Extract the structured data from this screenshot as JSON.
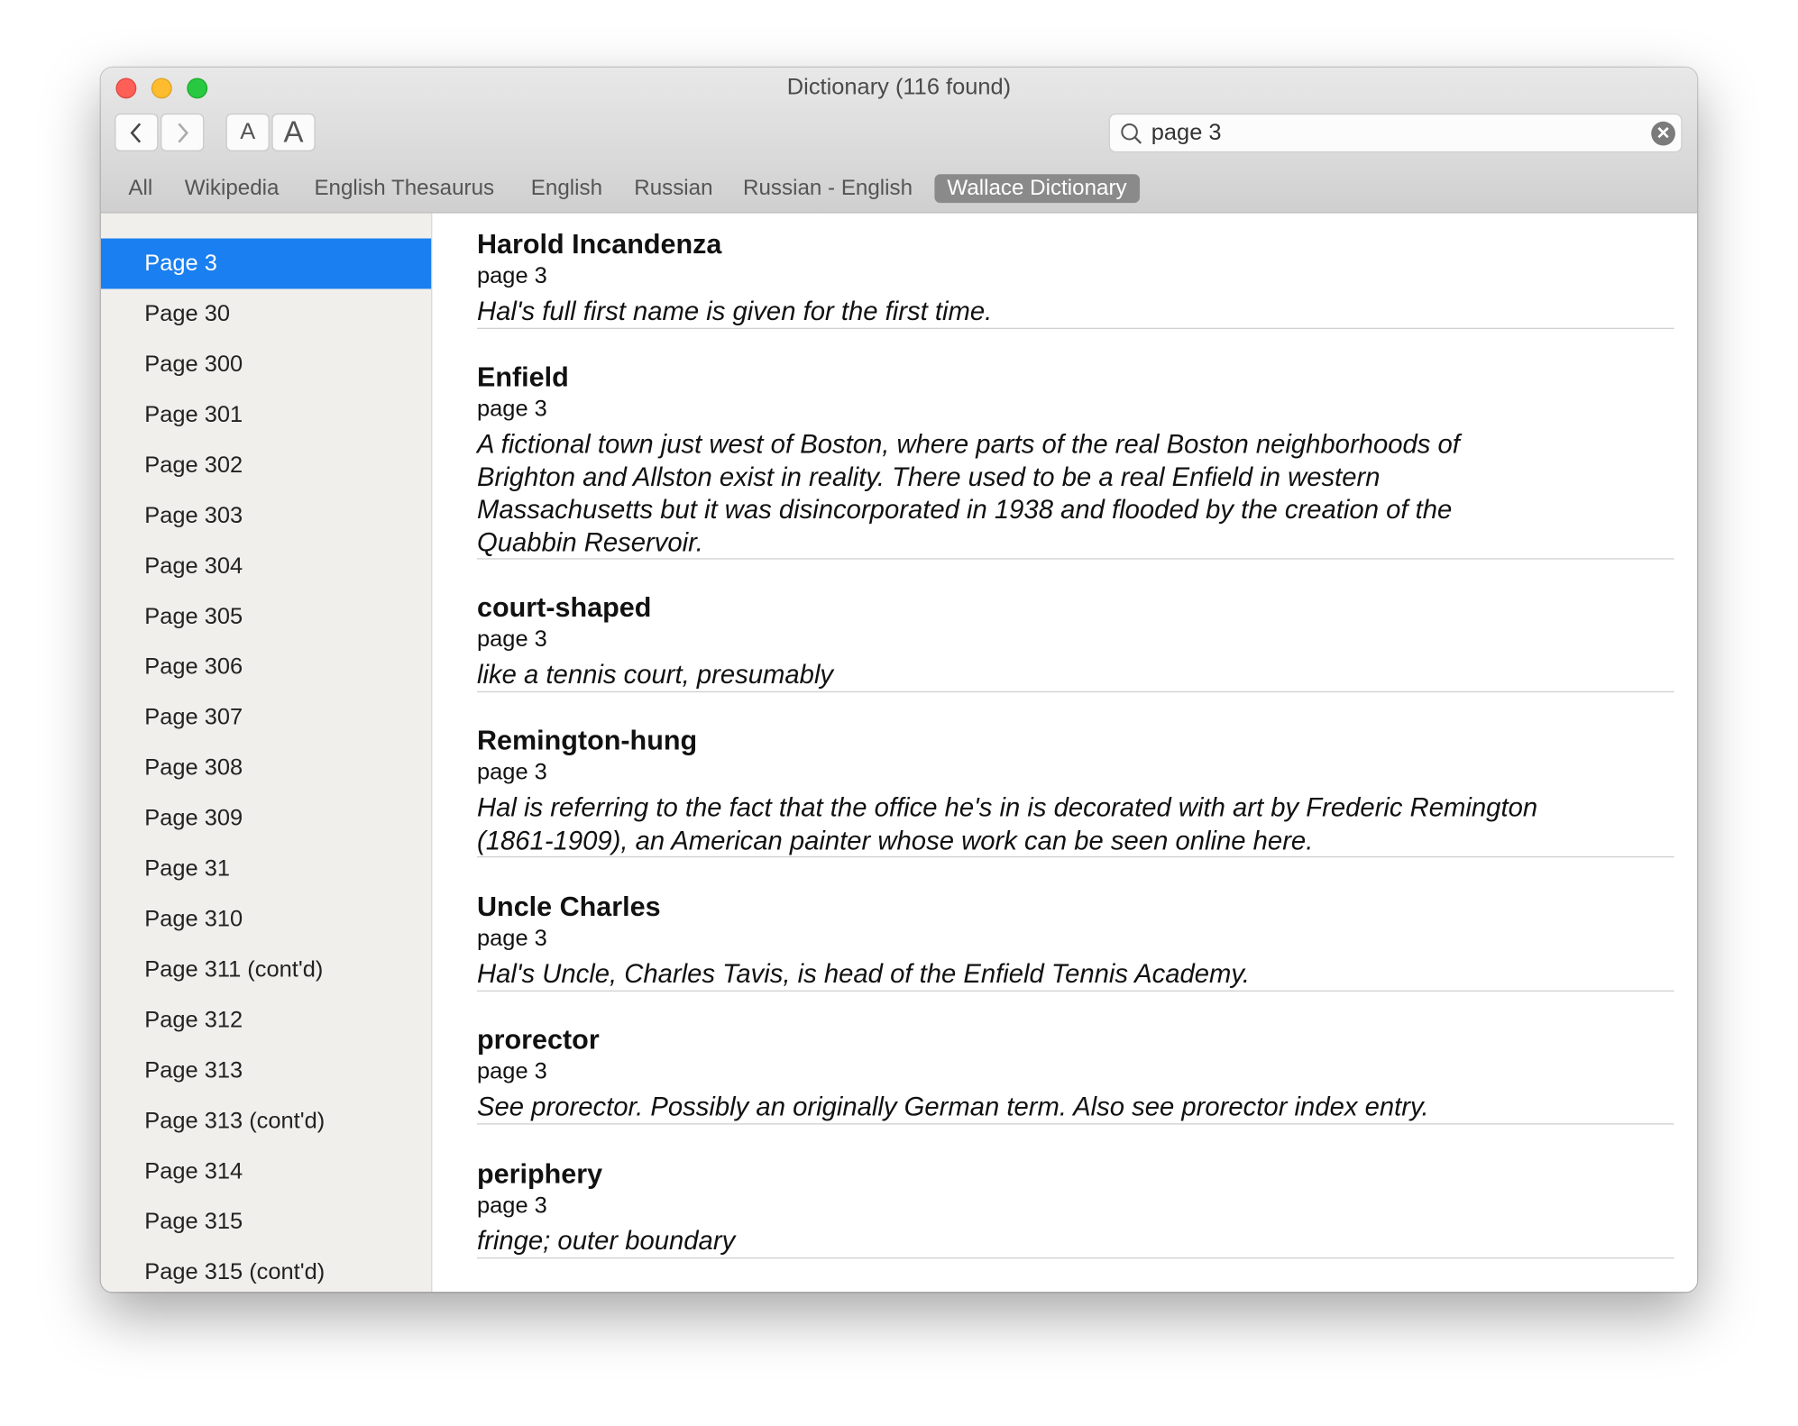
{
  "window": {
    "title": "Dictionary (116 found)"
  },
  "toolbar": {
    "back_icon": "chevron-left-icon",
    "forward_icon": "chevron-right-icon",
    "font_smaller": "A",
    "font_larger": "A"
  },
  "search": {
    "value": "page 3",
    "icon": "search-icon",
    "clear_icon": "clear-icon"
  },
  "tabs": [
    {
      "label": "All",
      "selected": false
    },
    {
      "label": "Wikipedia",
      "selected": false
    },
    {
      "label": "English Thesaurus",
      "selected": false
    },
    {
      "label": "English",
      "selected": false
    },
    {
      "label": "Russian",
      "selected": false
    },
    {
      "label": "Russian - English",
      "selected": false
    },
    {
      "label": "Wallace Dictionary",
      "selected": true
    }
  ],
  "sidebar": {
    "items": [
      "Page 3",
      "Page 30",
      "Page 300",
      "Page 301",
      "Page 302",
      "Page 303",
      "Page 304",
      "Page 305",
      "Page 306",
      "Page 307",
      "Page 308",
      "Page 309",
      "Page 31",
      "Page 310",
      "Page 311 (cont'd)",
      "Page 312",
      "Page 313",
      "Page 313 (cont'd)",
      "Page 314",
      "Page 315",
      "Page 315 (cont'd)"
    ],
    "selected_index": 0
  },
  "entries": [
    {
      "headword": "Harold Incandenza",
      "page": "page 3",
      "definition": [
        "Hal's full first name is given for the first time."
      ]
    },
    {
      "headword": "Enfield",
      "page": "page 3",
      "definition": [
        "A fictional town just west of Boston, where parts of the real Boston neighborhoods of",
        "Brighton and Allston exist in reality. There used to be a real Enfield in western",
        "Massachusetts but it was disincorporated in 1938 and flooded by the creation of the",
        "Quabbin Reservoir."
      ]
    },
    {
      "headword": "court-shaped",
      "page": "page 3",
      "definition": [
        "like a tennis court, presumably"
      ]
    },
    {
      "headword": "Remington-hung",
      "page": "page 3",
      "definition": [
        "Hal is referring to the fact that the office he's in is decorated with art by Frederic Remington",
        "(1861-1909), an American painter whose work can be seen online here."
      ]
    },
    {
      "headword": "Uncle Charles",
      "page": "page 3",
      "definition": [
        "Hal's Uncle, Charles Tavis, is head of the Enfield Tennis Academy."
      ]
    },
    {
      "headword": "prorector",
      "page": "page 3",
      "definition": [
        "See prorector. Possibly an originally German term. Also see prorector index entry."
      ]
    },
    {
      "headword": "periphery",
      "page": "page 3",
      "definition": [
        "fringe; outer boundary"
      ]
    }
  ],
  "colors": {
    "selection": "#1a7ff0",
    "close": "#fe5f57",
    "minimize": "#febc2e",
    "zoom": "#28c840"
  }
}
